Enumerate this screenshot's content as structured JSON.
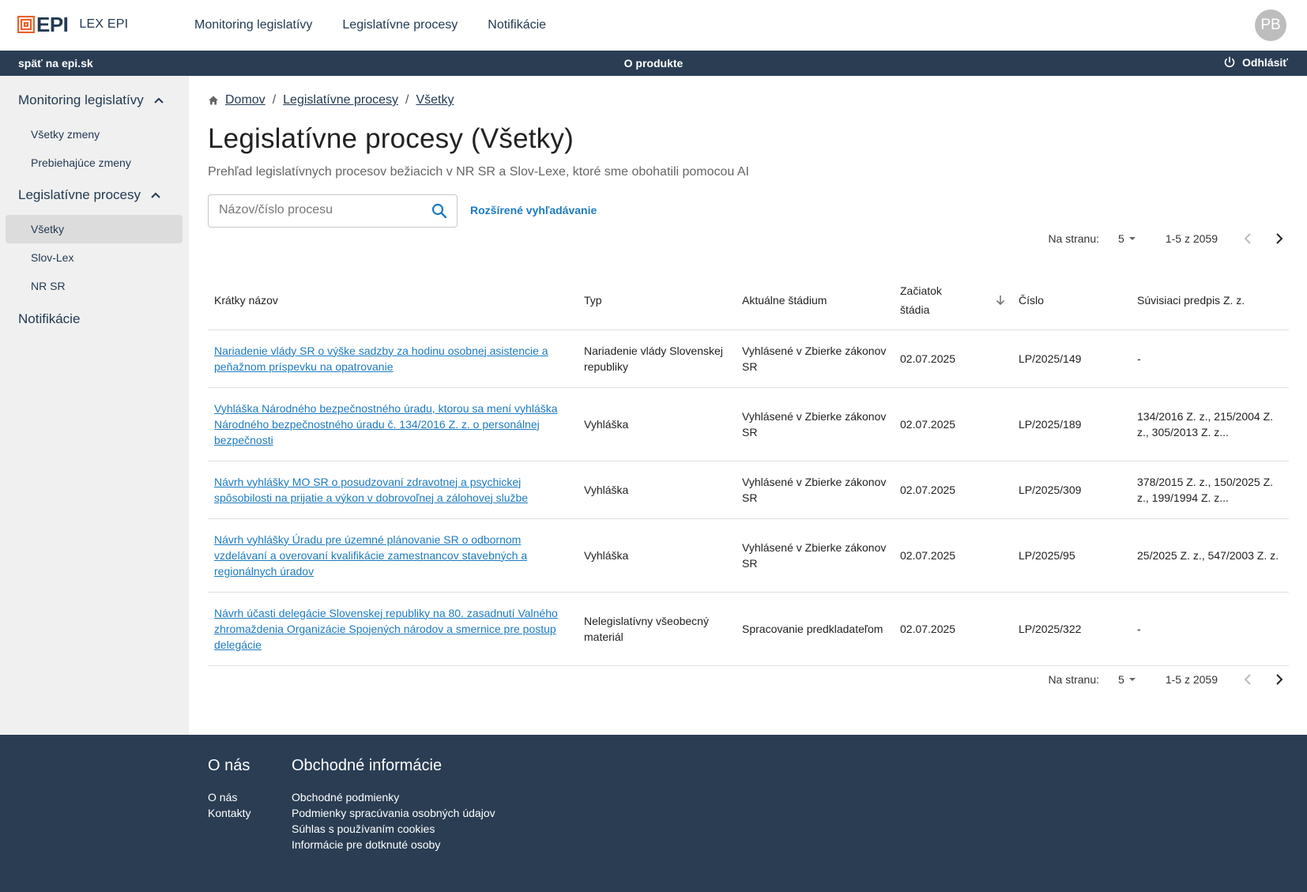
{
  "header": {
    "logo_text": "EPI",
    "product_name": "LEX EPI",
    "nav": [
      "Monitoring legislatívy",
      "Legislatívne procesy",
      "Notifikácie"
    ],
    "avatar_initials": "PB"
  },
  "subbar": {
    "back_label": "späť na epi.sk",
    "about_label": "O produkte",
    "logout_label": "Odhlásiť"
  },
  "sidebar": {
    "group1": "Monitoring legislatívy",
    "group1_items": [
      "Všetky zmeny",
      "Prebiehajúce zmeny"
    ],
    "group2": "Legislatívne procesy",
    "group2_items": [
      "Všetky",
      "Slov-Lex",
      "NR SR"
    ],
    "active_item": "Všetky",
    "group3": "Notifikácie"
  },
  "breadcrumb": [
    "Domov",
    "Legislatívne procesy",
    "Všetky"
  ],
  "page": {
    "title": "Legislatívne procesy (Všetky)",
    "subtitle": "Prehľad legislatívnych procesov bežiacich v NR SR a Slov-Lexe, ktoré sme obohatili pomocou AI"
  },
  "search": {
    "placeholder": "Názov/číslo procesu",
    "value": "",
    "advanced_label": "Rozšírené vyhľadávanie"
  },
  "pagination": {
    "per_page_label": "Na stranu:",
    "per_page_value": "5",
    "range": "1-5 z 2059"
  },
  "table": {
    "columns": [
      "Krátky názov",
      "Typ",
      "Aktuálne štádium",
      "Začiatok štádia",
      "Číslo",
      "Súvisiaci predpis Z. z."
    ],
    "sorted_column": "Začiatok štádia",
    "sort_direction": "descending",
    "rows": [
      {
        "name": "Nariadenie vlády SR o výške sadzby za hodinu osobnej asistencie a peňažnom príspevku na opatrovanie",
        "type": "Nariadenie vlády Slovenskej republiky",
        "stage": "Vyhlásené v Zbierke zákonov SR",
        "start": "02.07.2025",
        "number": "LP/2025/149",
        "related": "-"
      },
      {
        "name": "Vyhláška Národného bezpečnostného úradu, ktorou sa mení vyhláška Národného bezpečnostného úradu č. 134/2016 Z. z. o personálnej bezpečnosti",
        "type": "Vyhláška",
        "stage": "Vyhlásené v Zbierke zákonov SR",
        "start": "02.07.2025",
        "number": "LP/2025/189",
        "related": "134/2016 Z. z., 215/2004 Z. z., 305/2013 Z. z..."
      },
      {
        "name": "Návrh vyhlášky MO SR o posudzovaní zdravotnej a psychickej spôsobilosti na prijatie a výkon v dobrovoľnej a zálohovej službe",
        "type": "Vyhláška",
        "stage": "Vyhlásené v Zbierke zákonov SR",
        "start": "02.07.2025",
        "number": "LP/2025/309",
        "related": "378/2015 Z. z., 150/2025 Z. z., 199/1994 Z. z..."
      },
      {
        "name": "Návrh vyhlášky Úradu pre územné plánovanie SR o odbornom vzdelávaní a overovaní kvalifikácie zamestnancov stavebných a regionálnych úradov",
        "type": "Vyhláška",
        "stage": "Vyhlásené v Zbierke zákonov SR",
        "start": "02.07.2025",
        "number": "LP/2025/95",
        "related": "25/2025 Z. z., 547/2003 Z. z."
      },
      {
        "name": "Návrh účasti delegácie Slovenskej republiky na 80. zasadnutí Valného zhromaždenia Organizácie Spojených národov a smernice pre postup delegácie",
        "type": "Nelegislatívny všeobecný materiál",
        "stage": "Spracovanie predkladateľom",
        "start": "02.07.2025",
        "number": "LP/2025/322",
        "related": "-"
      }
    ]
  },
  "footer": {
    "col1_title": "O nás",
    "col1_links": [
      "O nás",
      "Kontakty"
    ],
    "col2_title": "Obchodné informácie",
    "col2_links": [
      "Obchodné podmienky",
      "Podmienky spracúvania osobných údajov",
      "Súhlas s používaním cookies",
      "Informácie pre dotknuté osoby"
    ]
  },
  "colors": {
    "brand_navy": "#2a3d53",
    "logo_orange": "#e8622c",
    "link_blue": "#1d7bbf",
    "sidebar_bg": "#f0f0f0",
    "sidebar_active": "#dcdcdc"
  }
}
